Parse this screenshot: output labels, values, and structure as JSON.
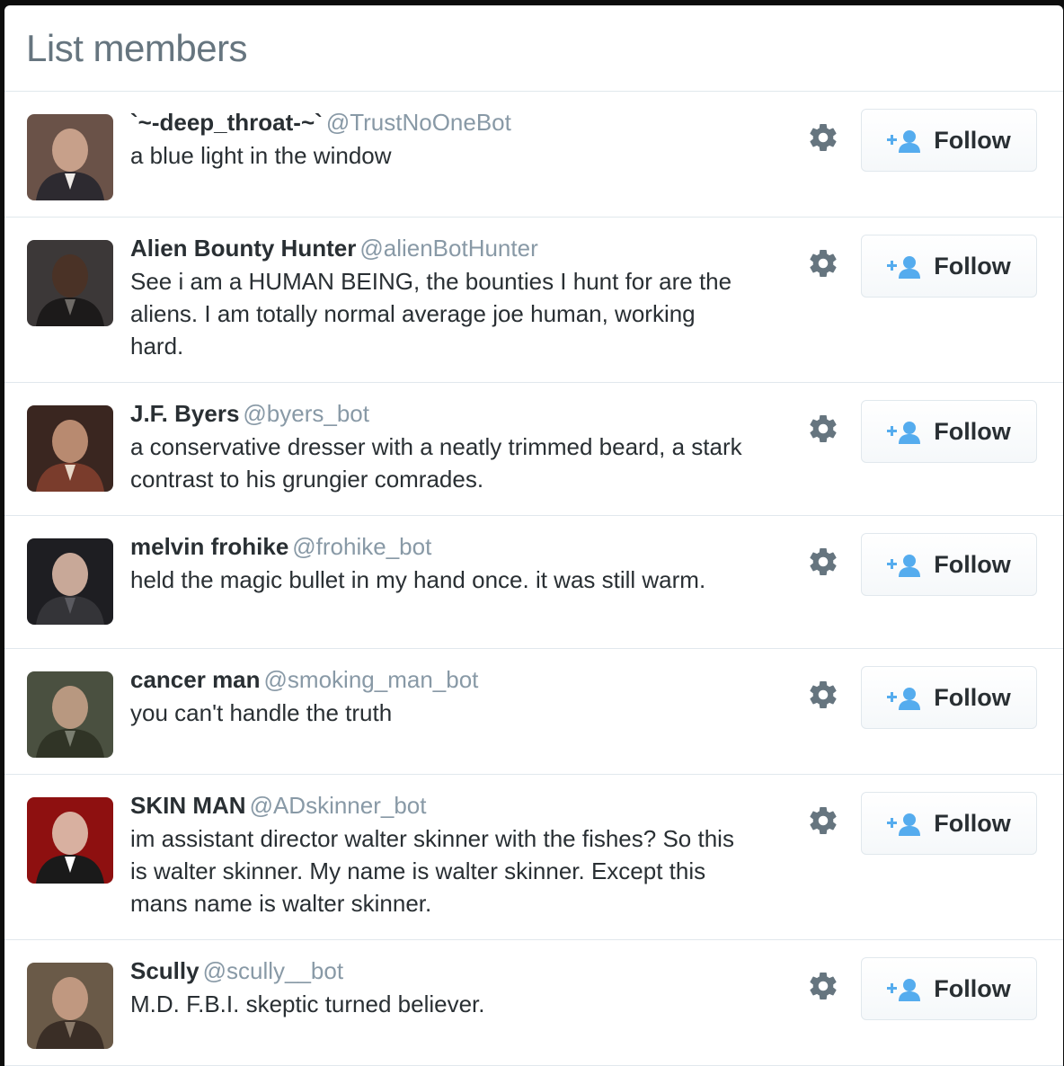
{
  "header": {
    "title": "List members"
  },
  "follow_label": "Follow",
  "colors": {
    "title": "#66757f",
    "name": "#292f33",
    "handle": "#8899a6",
    "follow_icon": "#55acee",
    "gear": "#66757f",
    "divider": "#e1e8ed"
  },
  "members": [
    {
      "name": "`~-deep_throat-~`",
      "handle": "@TrustNoOneBot",
      "bio": "a blue light in the window",
      "avatar_icon": "avatar-photo"
    },
    {
      "name": "Alien Bounty Hunter",
      "handle": "@alienBotHunter",
      "bio": "See i am a HUMAN BEING, the bounties I hunt for are the aliens. I am totally normal average joe human, working hard.",
      "avatar_icon": "avatar-photo"
    },
    {
      "name": "J.F. Byers",
      "handle": "@byers_bot",
      "bio": "a conservative dresser with a neatly trimmed beard, a stark contrast to his grungier comrades.",
      "avatar_icon": "avatar-photo"
    },
    {
      "name": "melvin frohike",
      "handle": "@frohike_bot",
      "bio": "held the magic bullet in my hand once. it was still warm.",
      "avatar_icon": "avatar-photo"
    },
    {
      "name": "cancer man",
      "handle": "@smoking_man_bot",
      "bio": "you can't handle the truth",
      "avatar_icon": "avatar-photo"
    },
    {
      "name": "SKIN MAN",
      "handle": "@ADskinner_bot",
      "bio": "im assistant director walter skinner with the fishes? So this is walter skinner. My name is walter skinner. Except this mans name is walter skinner.",
      "avatar_icon": "avatar-photo"
    },
    {
      "name": "Scully",
      "handle": "@scully__bot",
      "bio": "M.D. F.B.I. skeptic turned believer.",
      "avatar_icon": "avatar-photo"
    }
  ]
}
